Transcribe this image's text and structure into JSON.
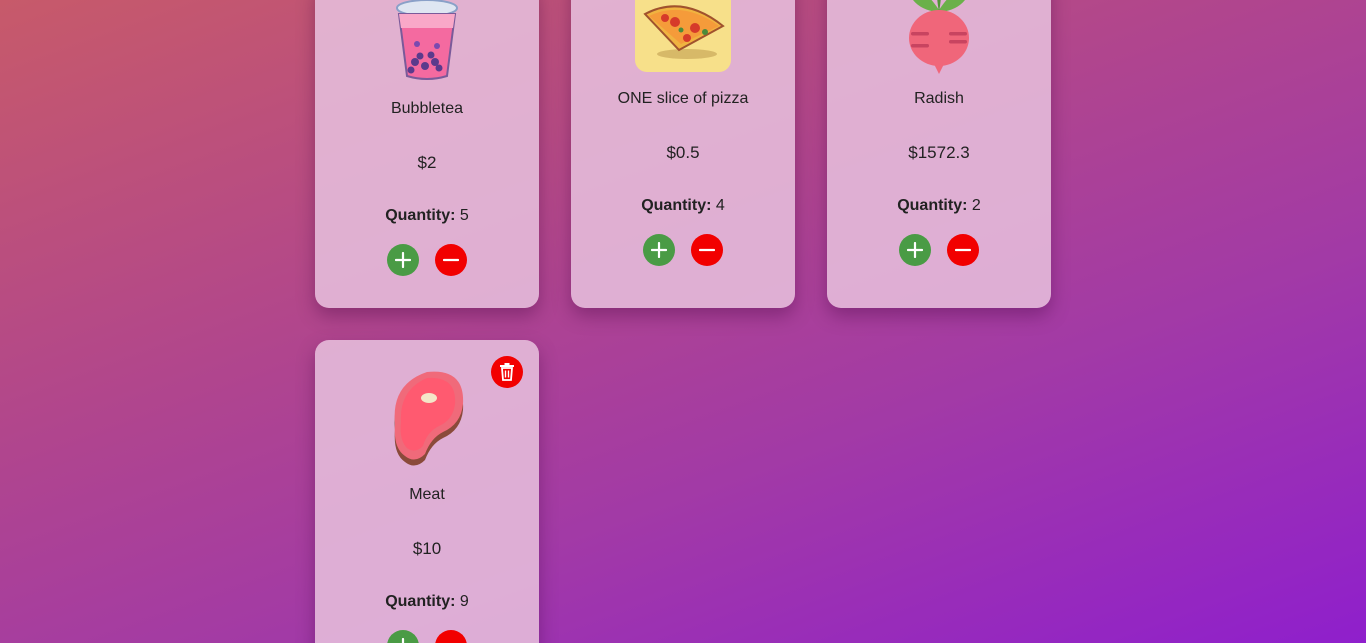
{
  "products": [
    {
      "name": "Bubbletea",
      "price": "$2",
      "quantity_label": "Quantity:",
      "quantity": "5",
      "image_icon": "bubble-tea-icon"
    },
    {
      "name": "ONE slice of pizza",
      "price": "$0.5",
      "quantity_label": "Quantity:",
      "quantity": "4",
      "image_icon": "pizza-icon"
    },
    {
      "name": "Radish",
      "price": "$1572.3",
      "quantity_label": "Quantity:",
      "quantity": "2",
      "image_icon": "radish-icon"
    },
    {
      "name": "Meat",
      "price": "$10",
      "quantity_label": "Quantity:",
      "quantity": "9",
      "image_icon": "meat-icon"
    }
  ],
  "colors": {
    "plus_button": "#4a9b45",
    "minus_button": "#f20000",
    "delete_button": "#f20000"
  }
}
